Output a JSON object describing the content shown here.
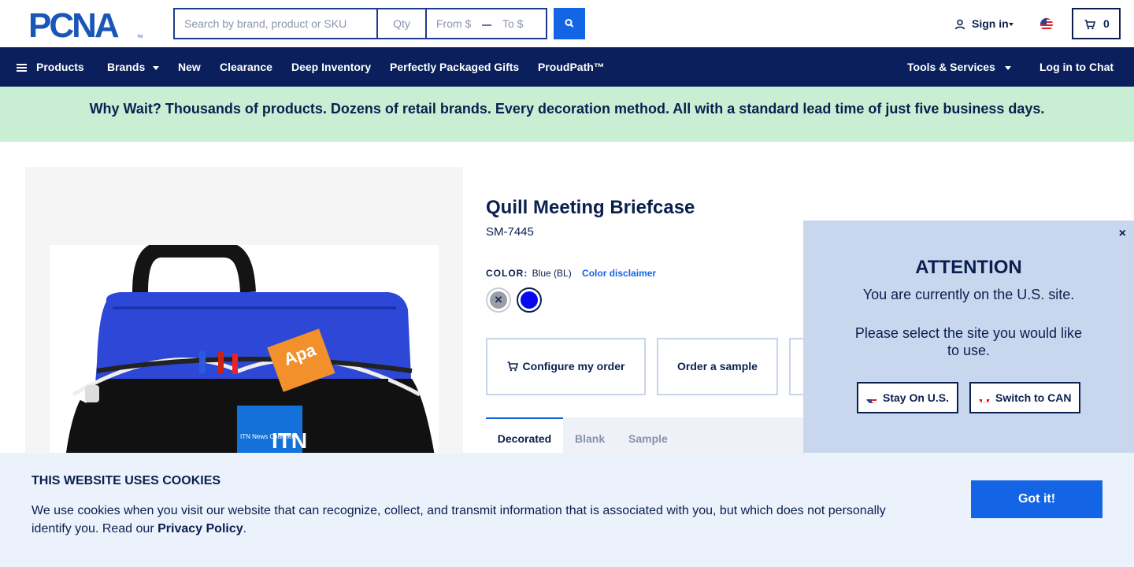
{
  "header": {
    "logo_text": "PCNA",
    "search_placeholder": "Search by brand, product or SKU",
    "qty_placeholder": "Qty",
    "price_from": "From $",
    "price_to": "To $",
    "sign_in": "Sign in",
    "cart_count": "0"
  },
  "nav": {
    "products": "Products",
    "brands": "Brands",
    "new": "New",
    "clearance": "Clearance",
    "deep_inventory": "Deep Inventory",
    "gifts": "Perfectly Packaged Gifts",
    "proudpath": "ProudPath™",
    "tools": "Tools & Services",
    "chat": "Log in to Chat"
  },
  "promo": "Why Wait? Thousands of products. Dozens of retail brands. Every decoration method. All with a standard lead time of just five business days.",
  "product": {
    "title": "Quill Meeting Briefcase",
    "sku": "SM-7445",
    "color_label": "COLOR:",
    "color_value": "Blue (BL)",
    "color_disclaimer": "Color disclaimer",
    "swatches": [
      {
        "name": "Gray",
        "color": "#9a9ea8",
        "unavailable": true
      },
      {
        "name": "Blue",
        "color": "#0707f2",
        "selected": true
      }
    ],
    "buttons": {
      "configure": "Configure my order",
      "sample": "Order a sample"
    },
    "tabs": [
      "Decorated",
      "Blank",
      "Sample"
    ],
    "image_text": {
      "label_small": "ITN News Channel",
      "label_big": "ITN",
      "book": "Apa"
    }
  },
  "modal": {
    "heading": "ATTENTION",
    "line1": "You are currently on the U.S. site.",
    "line2": "Please select the site you would like to use.",
    "stay": "Stay On U.S.",
    "switch": "Switch to CAN",
    "close": "×"
  },
  "cookies": {
    "title": "THIS WEBSITE USES COOKIES",
    "text": "We use cookies when you visit our website that can recognize, collect, and transmit information that is associated with you, but which does not personally identify you. Read our",
    "link": "Privacy Policy",
    "period": ".",
    "button": "Got it!"
  },
  "colors": {
    "navy": "#0a1f5c",
    "accent": "#1465e6",
    "promo_bg": "#c8efd4",
    "modal_bg": "#c9d7ee",
    "cookie_bg": "#ebf2fb"
  }
}
